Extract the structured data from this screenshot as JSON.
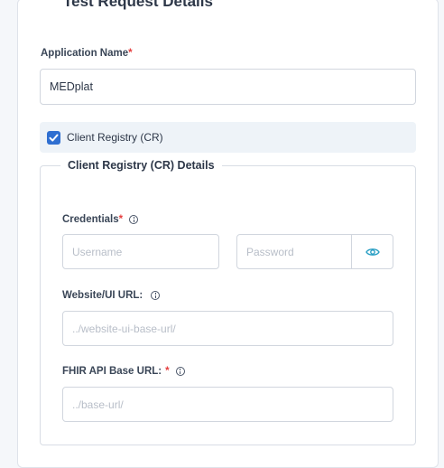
{
  "section": {
    "title": "Test Request Details"
  },
  "application_name": {
    "label": "Application Name",
    "required_mark": "*",
    "value": "MEDplat"
  },
  "client_registry_checkbox": {
    "label": "Client Registry (CR)",
    "checked": true
  },
  "cr_details": {
    "title": "Client Registry (CR) Details",
    "credentials": {
      "label": "Credentials",
      "required_mark": "*",
      "username_placeholder": "Username",
      "password_placeholder": "Password"
    },
    "website_url": {
      "label": "Website/UI URL:",
      "placeholder": "../website-ui-base-url/"
    },
    "fhir_url": {
      "label": "FHIR API Base URL:",
      "required_mark": "*",
      "placeholder": "../base-url/"
    }
  },
  "colors": {
    "accent": "#2f6fd1",
    "required": "#e53e3e",
    "eye_icon": "#2a9fc4"
  },
  "icons": [
    "checkmark-icon",
    "info-icon",
    "eye-icon"
  ]
}
